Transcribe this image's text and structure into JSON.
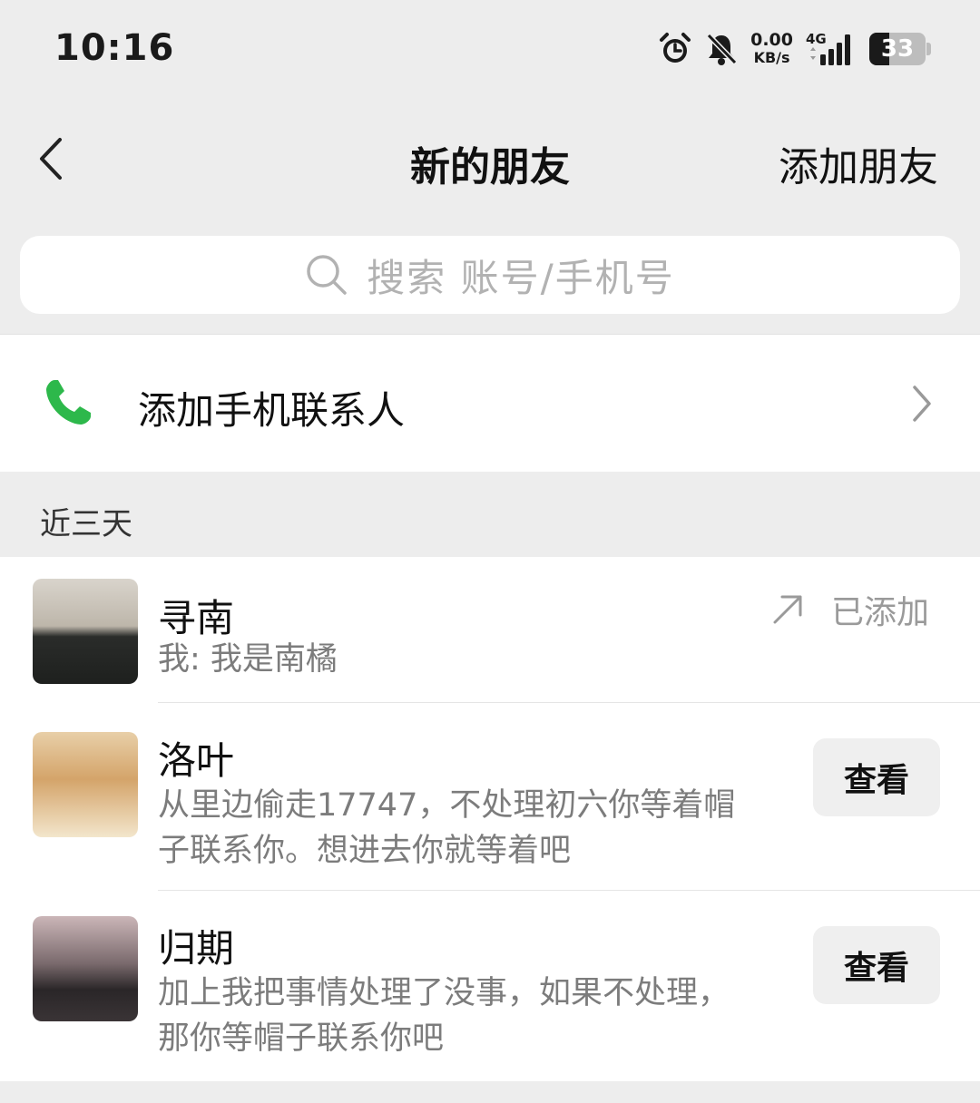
{
  "status_bar": {
    "time": "10:16",
    "net_speed_value": "0.00",
    "net_speed_unit": "KB/s",
    "network_type": "4G",
    "battery": "33",
    "icons": [
      "alarm-icon",
      "bell-off-icon",
      "signal-icon",
      "battery-icon"
    ]
  },
  "header": {
    "back_icon": "chevron-left-icon",
    "title": "新的朋友",
    "action_label": "添加朋友"
  },
  "search": {
    "icon": "search-icon",
    "placeholder": "搜索 账号/手机号"
  },
  "phone_contacts": {
    "icon": "phone-icon",
    "label": "添加手机联系人",
    "accent_color": "#2db84b"
  },
  "section": {
    "label": "近三天"
  },
  "requests": [
    {
      "name": "寻南",
      "message": "我: 我是南橘",
      "status": "已添加",
      "status_icon": "arrow-up-right-icon"
    },
    {
      "name": "洛叶",
      "message": "从里边偷走17747，不处理初六你等着帽子联系你。想进去你就等着吧",
      "action": "查看"
    },
    {
      "name": "归期",
      "message": "加上我把事情处理了没事，如果不处理，那你等帽子联系你吧",
      "action": "查看"
    }
  ]
}
